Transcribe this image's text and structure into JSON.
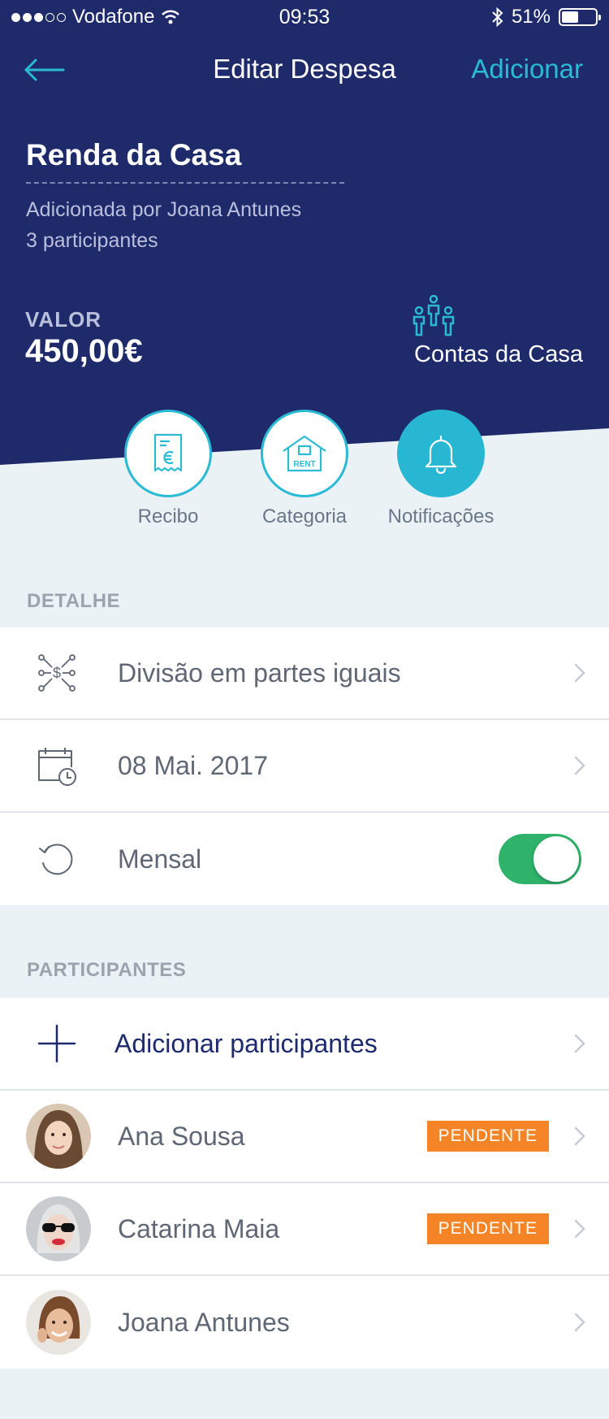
{
  "status_bar": {
    "carrier": "Vodafone",
    "time": "09:53",
    "battery": "51%",
    "battery_level": 0.51
  },
  "nav": {
    "title": "Editar Despesa",
    "action": "Adicionar"
  },
  "expense": {
    "name": "Renda da Casa",
    "added_by": "Adicionada por Joana Antunes",
    "participants_count": "3 participantes",
    "value_label": "VALOR",
    "value": "450,00€",
    "group": "Contas da Casa"
  },
  "actions": [
    {
      "label": "Recibo",
      "icon": "receipt-euro-icon"
    },
    {
      "label": "Categoria",
      "icon": "house-rent-icon"
    },
    {
      "label": "Notificações",
      "icon": "bell-icon"
    }
  ],
  "detail": {
    "header": "DETALHE",
    "items": [
      {
        "label": "Divisão em partes iguais",
        "icon": "split-money-icon"
      },
      {
        "label": "08 Mai. 2017",
        "icon": "calendar-clock-icon"
      },
      {
        "label": "Mensal",
        "icon": "recurring-icon",
        "toggle_on": true
      }
    ]
  },
  "participants": {
    "header": "PARTICIPANTES",
    "add_label": "Adicionar participantes",
    "items": [
      {
        "name": "Ana Sousa",
        "badge": "PENDENTE"
      },
      {
        "name": "Catarina Maia",
        "badge": "PENDENTE"
      },
      {
        "name": "Joana Antunes"
      }
    ]
  },
  "colors": {
    "header_bg": "#1f2a6a",
    "accent": "#2bbad4",
    "pending": "#f58426",
    "toggle_on": "#2fb36a",
    "background": "#ebf2f6"
  }
}
